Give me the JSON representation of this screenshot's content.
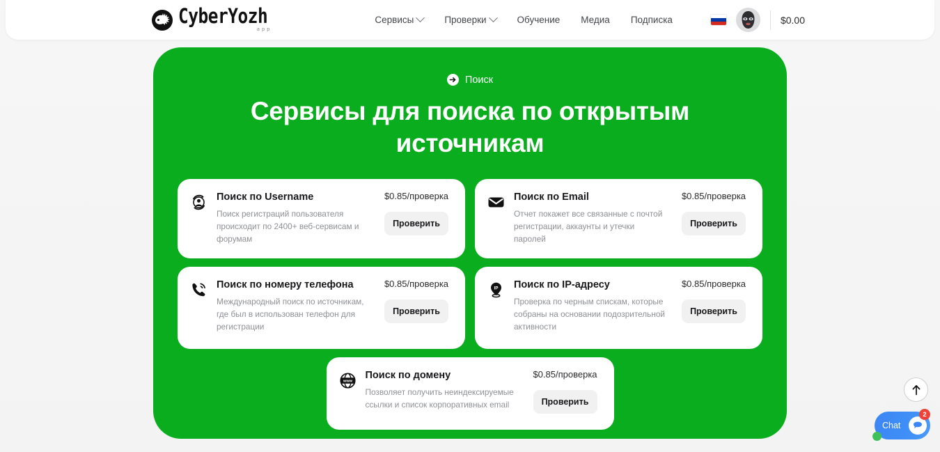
{
  "header": {
    "logo": {
      "text": "CyberYozh",
      "sub": "app",
      "icon": "hedgehog-icon"
    },
    "nav": [
      {
        "label": "Сервисы",
        "has_dropdown": true
      },
      {
        "label": "Проверки",
        "has_dropdown": true
      },
      {
        "label": "Обучение",
        "has_dropdown": false
      },
      {
        "label": "Медиа",
        "has_dropdown": false
      },
      {
        "label": "Подписка",
        "has_dropdown": false
      }
    ],
    "language_flag": "ru-flag-icon",
    "avatar": "balaclava-avatar",
    "balance": "$0.00"
  },
  "hero": {
    "eyebrow": "Поиск",
    "eyebrow_icon": "arrow-right-circle-icon",
    "title": "Сервисы для поиска по открытым источникам",
    "background_color": "#0aad1e"
  },
  "cards": [
    {
      "icon": "user-search-icon",
      "title": "Поиск по Username",
      "desc": "Поиск регистраций пользователя происходит по 2400+ веб-сервисам и форумам",
      "price": "$0.85/проверка",
      "button": "Проверить"
    },
    {
      "icon": "envelope-icon",
      "title": "Поиск по Email",
      "desc": "Отчет покажет все связанные с почтой регистрации, аккаунты и утечки паролей",
      "price": "$0.85/проверка",
      "button": "Проверить"
    },
    {
      "icon": "phone-icon",
      "title": "Поиск по номеру телефона",
      "desc": "Международный поиск по источникам, где был в использован телефон для регистрации",
      "price": "$0.85/проверка",
      "button": "Проверить"
    },
    {
      "icon": "ip-pin-icon",
      "title": "Поиск по IP-адресу",
      "desc": "Проверка по черным спискам, которые собраны на основании подозрительной активности",
      "price": "$0.85/проверка",
      "button": "Проверить"
    },
    {
      "icon": "globe-www-icon",
      "title": "Поиск по домену",
      "desc": "Позволяет получить неиндексируемые ссылки и список корпоративных email",
      "price": "$0.85/проверка",
      "button": "Проверить"
    }
  ],
  "floating": {
    "scroll_top_icon": "arrow-up-icon",
    "chat_label": "Chat",
    "chat_badge": "2",
    "chat_bubble_icon": "speech-bubble-icon",
    "online_indicator": "online-dot"
  }
}
